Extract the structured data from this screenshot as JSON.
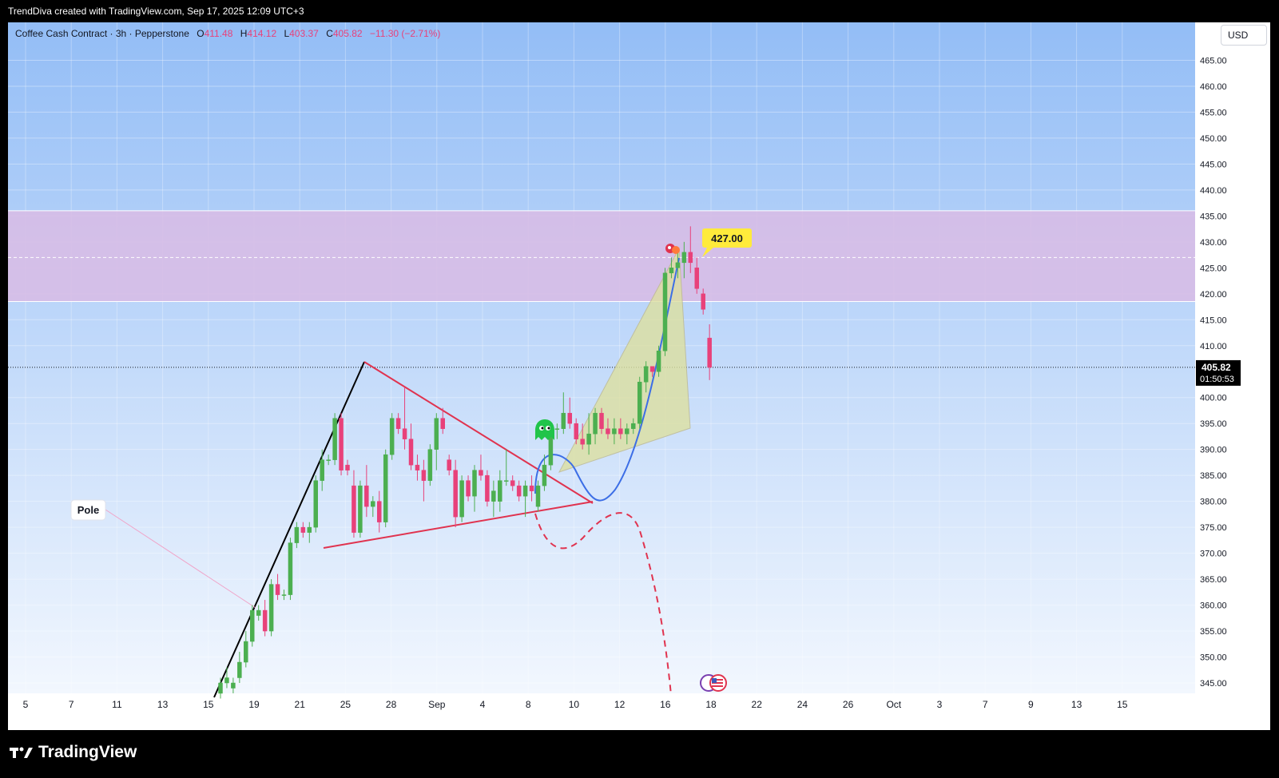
{
  "header": {
    "credit": "TrendDiva created with TradingView.com, Sep 17, 2025 12:09 UTC+3"
  },
  "legend": {
    "symbol": "Coffee Cash Contract · 3h · Pepperstone",
    "o_label": "O",
    "o_value": "411.48",
    "h_label": "H",
    "h_value": "414.12",
    "l_label": "L",
    "l_value": "403.37",
    "c_label": "C",
    "c_value": "405.82",
    "change": "−11.30 (−2.71%)"
  },
  "currency": "USD",
  "colors": {
    "bg_top": "#93bdf6",
    "bg_bottom": "#f2f7fe",
    "zone": "#d7bce6",
    "up": "#4caf50",
    "down": "#e8417a",
    "trend_black": "#000000",
    "triangle_red": "#e0334f",
    "curve_blue": "#3c6ee6",
    "projection_red": "#e0334f",
    "target_label": "#ffeb3b"
  },
  "chart_data": {
    "type": "candlestick",
    "timeframe": "3h",
    "ylim": [
      343,
      472
    ],
    "y_ticks": [
      465,
      460,
      455,
      450,
      445,
      440,
      435,
      430,
      425,
      420,
      415,
      410,
      400,
      395,
      390,
      385,
      380,
      375,
      370,
      365,
      360,
      355,
      350,
      345
    ],
    "x_ticks": [
      "5",
      "7",
      "11",
      "13",
      "15",
      "19",
      "21",
      "25",
      "28",
      "Sep",
      "4",
      "8",
      "10",
      "12",
      "16",
      "18",
      "22",
      "24",
      "26",
      "Oct",
      "3",
      "7",
      "9",
      "13",
      "15"
    ],
    "last_price": "405.82",
    "countdown": "01:50:53",
    "resistance_zone": [
      418.5,
      436
    ],
    "target_price_label": "427.00",
    "target_line": 427,
    "annotations": [
      "Pole",
      "427.00"
    ],
    "candles": [
      {
        "o": 343,
        "h": 346,
        "l": 342,
        "c": 345
      },
      {
        "o": 345,
        "h": 348,
        "l": 344,
        "c": 346
      },
      {
        "o": 344,
        "h": 346,
        "l": 343,
        "c": 345
      },
      {
        "o": 346,
        "h": 351,
        "l": 345,
        "c": 349
      },
      {
        "o": 349,
        "h": 355,
        "l": 348,
        "c": 353
      },
      {
        "o": 353,
        "h": 360,
        "l": 352,
        "c": 359
      },
      {
        "o": 358,
        "h": 360,
        "l": 357,
        "c": 359
      },
      {
        "o": 359,
        "h": 361,
        "l": 354,
        "c": 355
      },
      {
        "o": 355,
        "h": 365,
        "l": 354,
        "c": 364
      },
      {
        "o": 364,
        "h": 366,
        "l": 361,
        "c": 362
      },
      {
        "o": 362,
        "h": 363,
        "l": 361,
        "c": 362
      },
      {
        "o": 362,
        "h": 373,
        "l": 361,
        "c": 372
      },
      {
        "o": 372,
        "h": 376,
        "l": 371,
        "c": 375
      },
      {
        "o": 375,
        "h": 376,
        "l": 373,
        "c": 374
      },
      {
        "o": 374,
        "h": 376,
        "l": 372,
        "c": 375
      },
      {
        "o": 375,
        "h": 385,
        "l": 374,
        "c": 384
      },
      {
        "o": 384,
        "h": 390,
        "l": 382,
        "c": 388
      },
      {
        "o": 388,
        "h": 389,
        "l": 387,
        "c": 388
      },
      {
        "o": 388,
        "h": 397,
        "l": 387,
        "c": 396
      },
      {
        "o": 396,
        "h": 397,
        "l": 385,
        "c": 386
      },
      {
        "o": 387,
        "h": 388,
        "l": 385,
        "c": 386
      },
      {
        "o": 383,
        "h": 386,
        "l": 373,
        "c": 374
      },
      {
        "o": 374,
        "h": 384,
        "l": 373,
        "c": 383
      },
      {
        "o": 383,
        "h": 387,
        "l": 377,
        "c": 379
      },
      {
        "o": 379,
        "h": 381,
        "l": 377,
        "c": 380
      },
      {
        "o": 380,
        "h": 382,
        "l": 374,
        "c": 376
      },
      {
        "o": 376,
        "h": 390,
        "l": 375,
        "c": 389
      },
      {
        "o": 389,
        "h": 397,
        "l": 388,
        "c": 396
      },
      {
        "o": 396,
        "h": 397,
        "l": 393,
        "c": 394
      },
      {
        "o": 394,
        "h": 402,
        "l": 390,
        "c": 392
      },
      {
        "o": 392,
        "h": 395,
        "l": 386,
        "c": 387
      },
      {
        "o": 387,
        "h": 389,
        "l": 384,
        "c": 386
      },
      {
        "o": 386,
        "h": 388,
        "l": 380,
        "c": 384
      },
      {
        "o": 384,
        "h": 391,
        "l": 383,
        "c": 390
      },
      {
        "o": 390,
        "h": 397,
        "l": 386,
        "c": 396
      },
      {
        "o": 396,
        "h": 398,
        "l": 393,
        "c": 394
      },
      {
        "o": 388,
        "h": 389,
        "l": 385,
        "c": 386
      },
      {
        "o": 386,
        "h": 388,
        "l": 375,
        "c": 377
      },
      {
        "o": 377,
        "h": 385,
        "l": 376,
        "c": 384
      },
      {
        "o": 384,
        "h": 385,
        "l": 380,
        "c": 381
      },
      {
        "o": 381,
        "h": 387,
        "l": 378,
        "c": 386
      },
      {
        "o": 386,
        "h": 389,
        "l": 384,
        "c": 385
      },
      {
        "o": 385,
        "h": 386,
        "l": 379,
        "c": 380
      },
      {
        "o": 380,
        "h": 384,
        "l": 377,
        "c": 382
      },
      {
        "o": 380,
        "h": 386,
        "l": 378,
        "c": 384
      },
      {
        "o": 384,
        "h": 390,
        "l": 383,
        "c": 384
      },
      {
        "o": 384,
        "h": 385,
        "l": 382,
        "c": 383
      },
      {
        "o": 383,
        "h": 384,
        "l": 380,
        "c": 381
      },
      {
        "o": 381,
        "h": 384,
        "l": 377,
        "c": 383
      },
      {
        "o": 383,
        "h": 385,
        "l": 380,
        "c": 382
      },
      {
        "o": 379,
        "h": 384,
        "l": 378,
        "c": 383
      },
      {
        "o": 383,
        "h": 389,
        "l": 382,
        "c": 387
      },
      {
        "o": 387,
        "h": 395,
        "l": 386,
        "c": 394
      },
      {
        "o": 394,
        "h": 395,
        "l": 392,
        "c": 394
      },
      {
        "o": 394,
        "h": 401,
        "l": 393,
        "c": 397
      },
      {
        "o": 397,
        "h": 400,
        "l": 394,
        "c": 395
      },
      {
        "o": 395,
        "h": 396,
        "l": 391,
        "c": 392
      },
      {
        "o": 392,
        "h": 395,
        "l": 390,
        "c": 391
      },
      {
        "o": 391,
        "h": 397,
        "l": 389,
        "c": 393
      },
      {
        "o": 393,
        "h": 398,
        "l": 391,
        "c": 397
      },
      {
        "o": 397,
        "h": 398,
        "l": 393,
        "c": 394
      },
      {
        "o": 394,
        "h": 396,
        "l": 392,
        "c": 393
      },
      {
        "o": 393,
        "h": 396,
        "l": 391,
        "c": 394
      },
      {
        "o": 394,
        "h": 396,
        "l": 392,
        "c": 393
      },
      {
        "o": 393,
        "h": 395,
        "l": 391,
        "c": 394
      },
      {
        "o": 394,
        "h": 396,
        "l": 393,
        "c": 395
      },
      {
        "o": 395,
        "h": 404,
        "l": 394,
        "c": 403
      },
      {
        "o": 403,
        "h": 407,
        "l": 401,
        "c": 406
      },
      {
        "o": 406,
        "h": 406,
        "l": 404,
        "c": 405
      },
      {
        "o": 405,
        "h": 410,
        "l": 404,
        "c": 409
      },
      {
        "o": 409,
        "h": 425,
        "l": 408,
        "c": 424
      },
      {
        "o": 424,
        "h": 427,
        "l": 423,
        "c": 425
      },
      {
        "o": 425,
        "h": 429,
        "l": 423,
        "c": 426
      },
      {
        "o": 426,
        "h": 430,
        "l": 423,
        "c": 428
      },
      {
        "o": 428,
        "h": 433,
        "l": 424,
        "c": 426
      },
      {
        "o": 425,
        "h": 427,
        "l": 420,
        "c": 421
      },
      {
        "o": 420,
        "h": 421,
        "l": 416,
        "c": 417
      },
      {
        "o": 411.48,
        "h": 414.12,
        "l": 403.37,
        "c": 405.82
      }
    ]
  }
}
